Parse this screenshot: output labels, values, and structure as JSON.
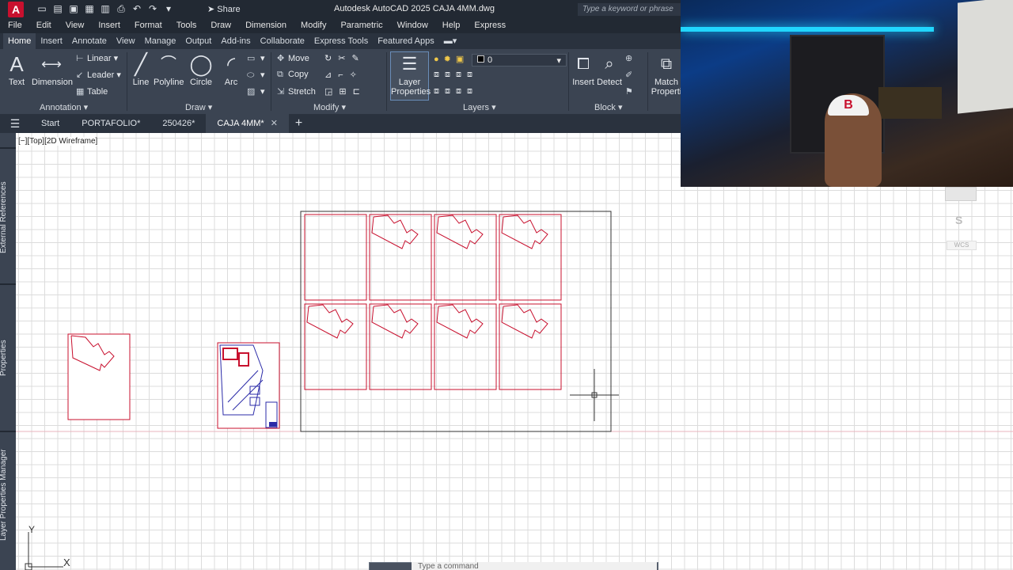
{
  "app": {
    "logo": "A",
    "title": "Autodesk AutoCAD 2025   CAJA 4MM.dwg",
    "share": "Share",
    "search_placeholder": "Type a keyword or phrase"
  },
  "menu": [
    "File",
    "Edit",
    "View",
    "Insert",
    "Format",
    "Tools",
    "Draw",
    "Dimension",
    "Modify",
    "Parametric",
    "Window",
    "Help",
    "Express"
  ],
  "ribbon_tabs": [
    "Home",
    "Insert",
    "Annotate",
    "View",
    "Manage",
    "Output",
    "Add-ins",
    "Collaborate",
    "Express Tools",
    "Featured Apps"
  ],
  "ribbon": {
    "annotation": {
      "title": "Annotation",
      "text": "Text",
      "dimension": "Dimension",
      "linear": "Linear",
      "leader": "Leader",
      "table": "Table"
    },
    "draw": {
      "title": "Draw",
      "line": "Line",
      "polyline": "Polyline",
      "circle": "Circle",
      "arc": "Arc"
    },
    "modify": {
      "title": "Modify",
      "move": "Move",
      "copy": "Copy",
      "stretch": "Stretch"
    },
    "layers": {
      "title": "Layers",
      "layer_properties_line1": "Layer",
      "layer_properties_line2": "Properties",
      "current_layer": "0"
    },
    "block": {
      "title": "Block",
      "insert": "Insert",
      "detect": "Detect"
    },
    "properties": {
      "match_line1": "Match",
      "match_line2": "Properti"
    }
  },
  "file_tabs": {
    "start": "Start",
    "tabs": [
      "PORTAFOLIO*",
      "250426*",
      "CAJA 4MM*"
    ],
    "close": "✕",
    "add": "+"
  },
  "palettes": [
    "External References",
    "Properties",
    "Layer Properties Manager"
  ],
  "viewport_label": "[−][Top][2D Wireframe]",
  "ucs": {
    "y": "Y",
    "x": "X"
  },
  "viewcube": {
    "compass": "S",
    "wcs": "WCS"
  },
  "command": {
    "placeholder": "Type a command"
  },
  "colors": {
    "outline": "#c8102e",
    "frame": "#333333",
    "plan_blue": "#2b2ba8",
    "grid": "#dcdcdc"
  }
}
